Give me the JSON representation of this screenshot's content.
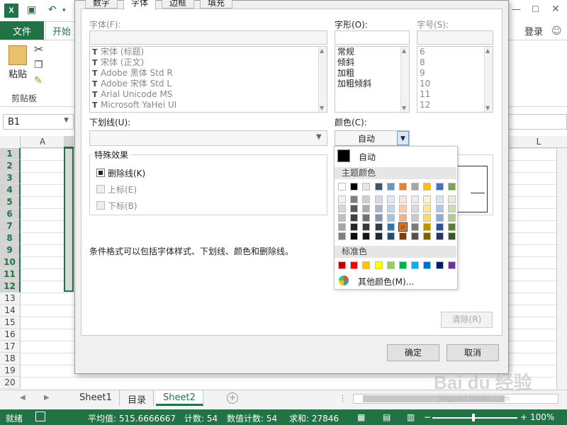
{
  "app": {
    "title_tabs": {
      "file": "文件",
      "home": "开始"
    },
    "login": "登录",
    "clipboard": {
      "paste": "粘贴",
      "group": "剪贴板"
    },
    "namebox": "B1",
    "columns": [
      "A",
      "L"
    ],
    "rows": [
      "1",
      "2",
      "3",
      "4",
      "5",
      "6",
      "7",
      "8",
      "9",
      "10",
      "11",
      "12",
      "13",
      "14",
      "15",
      "16",
      "17",
      "18",
      "19",
      "20"
    ],
    "selected_rows": 12,
    "sheets": [
      "Sheet1",
      "目录",
      "Sheet2"
    ],
    "active_sheet": "Sheet2",
    "status": {
      "ready": "就绪",
      "average": "平均值: 515.6666667",
      "count": "计数: 54",
      "numcount": "数值计数: 54",
      "sum": "求和: 27846",
      "zoom": "100%"
    },
    "accent": "#217346"
  },
  "dialog": {
    "tabs": [
      "数字",
      "字体",
      "边框",
      "填充"
    ],
    "active_tab": "字体",
    "font_label": "字体(F):",
    "style_label": "字形(O):",
    "size_label": "字号(S):",
    "fonts": [
      "宋体 (标题)",
      "宋体 (正文)",
      "Adobe 黑体 Std R",
      "Adobe 宋体 Std L",
      "Arial Unicode MS",
      "Microsoft YaHei UI"
    ],
    "styles": [
      "常规",
      "倾斜",
      "加粗",
      "加粗倾斜"
    ],
    "sizes": [
      "6",
      "8",
      "9",
      "10",
      "11",
      "12"
    ],
    "underline_label": "下划线(U):",
    "color_label": "颜色(C):",
    "color_value": "自动",
    "effects_title": "特殊效果",
    "effects": [
      {
        "label": "删除线(K)",
        "checked": true,
        "enabled": true
      },
      {
        "label": "上标(E)",
        "checked": false,
        "enabled": false
      },
      {
        "label": "下标(B)",
        "checked": false,
        "enabled": false
      }
    ],
    "hint": "条件格式可以包括字体样式、下划线、颜色和删除线。",
    "clear": "清除(R)",
    "ok": "确定",
    "cancel": "取消"
  },
  "palette": {
    "auto": "自动",
    "theme_header": "主题颜色",
    "standard_header": "标准色",
    "more": "其他颜色(M)...",
    "theme_top": [
      "#ffffff",
      "#000000",
      "#e7e6e6",
      "#44546a",
      "#5b9bd5",
      "#ed7d31",
      "#a5a5a5",
      "#ffc000",
      "#4472c4",
      "#70ad47"
    ],
    "theme_shades": [
      [
        "#f2f2f2",
        "#7f7f7f",
        "#d0cece",
        "#d6dce4",
        "#deebf6",
        "#fbe5d5",
        "#ededed",
        "#fff2cc",
        "#dae3f3",
        "#e2efd9"
      ],
      [
        "#d8d8d8",
        "#595959",
        "#aeabab",
        "#adb9ca",
        "#bdd7ee",
        "#f7cbac",
        "#dbdbdb",
        "#fee599",
        "#b4c6e7",
        "#c5e0b3"
      ],
      [
        "#bfbfbf",
        "#3f3f3f",
        "#757070",
        "#8496b0",
        "#9dc3e6",
        "#f4b183",
        "#c9c9c9",
        "#ffd965",
        "#8eaadb",
        "#a8d08d"
      ],
      [
        "#a5a5a5",
        "#262626",
        "#3a3838",
        "#323f4f",
        "#2e75b5",
        "#c55a11",
        "#7b7b7b",
        "#bf9000",
        "#2f5496",
        "#538135"
      ],
      [
        "#7f7f7f",
        "#0c0c0c",
        "#171616",
        "#222a35",
        "#1e4e79",
        "#833c0b",
        "#525252",
        "#7f6000",
        "#1f3864",
        "#375623"
      ]
    ],
    "standard": [
      "#c00000",
      "#ff0000",
      "#ffc000",
      "#ffff00",
      "#92d050",
      "#00b050",
      "#00b0f0",
      "#0070c0",
      "#002060",
      "#7030a0"
    ],
    "selected": "#c55a11"
  },
  "watermark": {
    "brand": "Baidu经验",
    "url": "jingyan.baidu.com"
  }
}
